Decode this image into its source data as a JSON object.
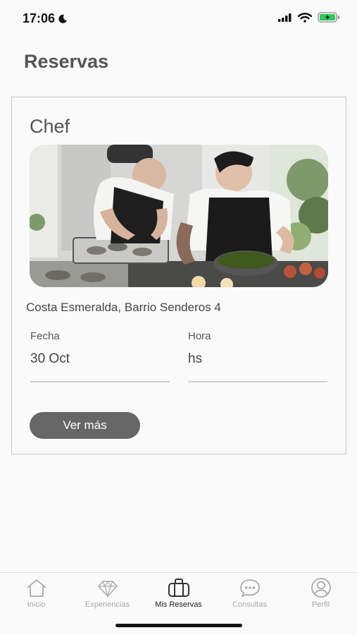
{
  "status_bar": {
    "time": "17:06"
  },
  "page": {
    "title": "Reservas"
  },
  "reservation": {
    "title": "Chef",
    "address": "Costa Esmeralda, Barrio Senderos 4",
    "date_label": "Fecha",
    "date_value": "30 Oct",
    "time_label": "Hora",
    "time_value": "hs",
    "button_label": "Ver más"
  },
  "tab_bar": {
    "items": [
      {
        "label": "Inicio",
        "icon": "home-icon",
        "active": false
      },
      {
        "label": "Experiencias",
        "icon": "diamond-icon",
        "active": false
      },
      {
        "label": "Mis Reservas",
        "icon": "briefcase-icon",
        "active": true
      },
      {
        "label": "Consultas",
        "icon": "chat-icon",
        "active": false
      },
      {
        "label": "Perfil",
        "icon": "profile-icon",
        "active": false
      }
    ]
  },
  "colors": {
    "accent_active": "#222222",
    "inactive": "#aaaaaa",
    "button": "#666666"
  }
}
